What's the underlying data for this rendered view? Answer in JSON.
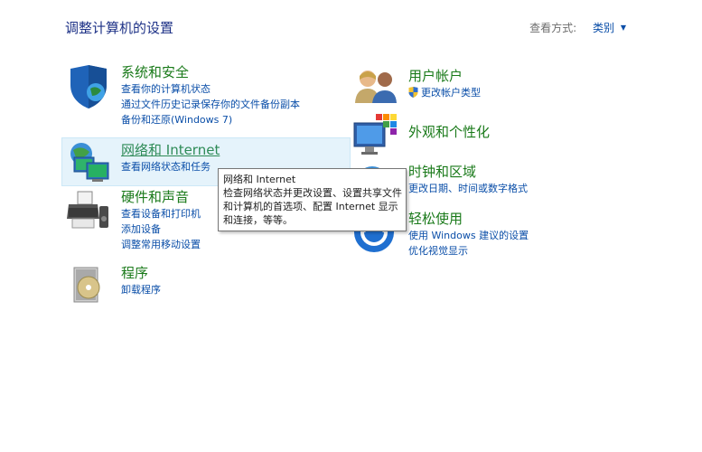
{
  "page_title": "调整计算机的设置",
  "view_by": {
    "label": "查看方式:",
    "value": "类别"
  },
  "categories": {
    "system": {
      "title": "系统和安全",
      "links": [
        "查看你的计算机状态",
        "通过文件历史记录保存你的文件备份副本",
        "备份和还原(Windows 7)"
      ]
    },
    "network": {
      "title": "网络和 Internet",
      "links": [
        "查看网络状态和任务"
      ]
    },
    "hardware": {
      "title": "硬件和声音",
      "links": [
        "查看设备和打印机",
        "添加设备",
        "调整常用移动设置"
      ]
    },
    "programs": {
      "title": "程序",
      "links": [
        "卸载程序"
      ]
    },
    "users": {
      "title": "用户帐户",
      "links": [
        "更改帐户类型"
      ]
    },
    "appearance": {
      "title": "外观和个性化",
      "links": []
    },
    "clock": {
      "title": "时钟和区域",
      "links": [
        "更改日期、时间或数字格式"
      ]
    },
    "ease": {
      "title": "轻松使用",
      "links": [
        "使用 Windows 建议的设置",
        "优化视觉显示"
      ]
    }
  },
  "tooltip": {
    "title": "网络和 Internet",
    "body": "检查网络状态并更改设置、设置共享文件和计算机的首选项、配置 Internet 显示和连接，等等。"
  },
  "colors": {
    "title_blue": "#1e3287",
    "link_blue": "#0a4ea8",
    "category_green": "#1a7a1a",
    "hover_bg": "#e5f3fb"
  },
  "icons": {
    "system": "shield-globe-icon",
    "network": "network-globe-monitors-icon",
    "hardware": "printer-speaker-icon",
    "programs": "programs-disc-box-icon",
    "users": "users-icon",
    "appearance": "monitor-palette-icon",
    "clock": "clock-globe-icon",
    "ease": "ease-of-access-icon"
  }
}
